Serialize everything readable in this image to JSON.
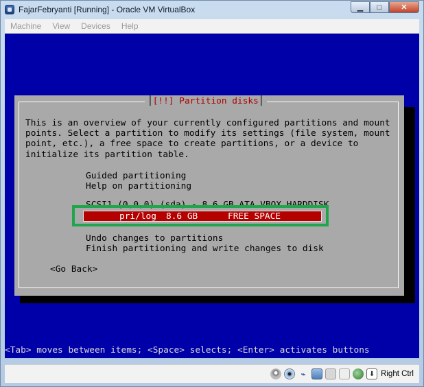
{
  "window": {
    "title": "FajarFebryanti [Running] - Oracle VM VirtualBox",
    "controls": {
      "minimize": "▁",
      "maximize": "□",
      "close": "✕"
    }
  },
  "menubar": {
    "items": [
      {
        "label": "Machine"
      },
      {
        "label": "View"
      },
      {
        "label": "Devices"
      },
      {
        "label": "Help"
      }
    ]
  },
  "installer": {
    "dialog_title": "[!!] Partition disks",
    "intro_lines": [
      "This is an overview of your currently configured partitions and mount",
      "points. Select a partition to modify its settings (file system, mount",
      "point, etc.), a free space to create partitions, or a device to",
      "initialize its partition table."
    ],
    "options_top": [
      "Guided partitioning",
      "Help on partitioning"
    ],
    "disk_line": "SCSI1 (0,0,0) (sda) - 8.6 GB ATA VBOX HARDDISK",
    "selected_row": {
      "type": "pri/log",
      "size": "8.6 GB",
      "label": "FREE SPACE"
    },
    "options_bottom": [
      "Undo changes to partitions",
      "Finish partitioning and write changes to disk"
    ],
    "go_back": "<Go Back>",
    "help_line": "<Tab> moves between items; <Space> selects; <Enter> activates buttons"
  },
  "statusbar": {
    "host_key": "Right Ctrl",
    "icons": [
      "hard-disk-icon",
      "optical-drive-icon",
      "usb-icon",
      "network-icon",
      "shared-folders-icon",
      "video-capture-icon",
      "mouse-integration-icon",
      "host-key-icon"
    ]
  },
  "colors": {
    "screen_bg": "#0000a8",
    "dialog_bg": "#a9a9a9",
    "selection_bg": "#b50000",
    "title_text": "#b00000",
    "annotation_box": "#1fa64b"
  }
}
